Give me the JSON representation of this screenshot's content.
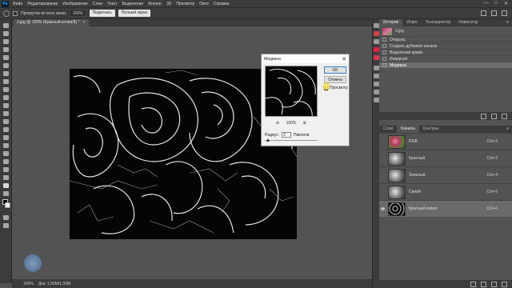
{
  "menu": {
    "items": [
      "Файл",
      "Редактирование",
      "Изображение",
      "Слои",
      "Текст",
      "Выделение",
      "Фильтр",
      "3D",
      "Просмотр",
      "Окно",
      "Справка"
    ],
    "window_controls": [
      "—",
      "□",
      "✕"
    ]
  },
  "options": {
    "scroll_all_label": "Прокрутка во всех окнах",
    "zoom_value": "100%",
    "fit_button": "Подогнать",
    "fill_button": "Полный экран"
  },
  "document": {
    "tab_title": "3.jpg @ 100% (Красный копия/8) *",
    "close": "×"
  },
  "status": {
    "zoom": "100%",
    "doc_info": "Док: 1,50M/1,50M"
  },
  "dialog": {
    "title": "Медиана",
    "close": "✕",
    "ok_label": "OK",
    "cancel_label": "Отмена",
    "preview_label": "Просмотр",
    "preview_checked": true,
    "zoom_out": "⊖",
    "zoom_value": "100%",
    "zoom_in": "⊕",
    "radius_label": "Радиус:",
    "radius_value": "2",
    "radius_unit": "Пиксели"
  },
  "history": {
    "tabs": [
      "История",
      "Инфо",
      "Тонкорректор",
      "Навигатор"
    ],
    "snapshot": "3.jpg",
    "items": [
      {
        "label": "Открыть",
        "selected": false
      },
      {
        "label": "Создать дубликат канала",
        "selected": false
      },
      {
        "label": "Выделение краев",
        "selected": false
      },
      {
        "label": "Инверсия",
        "selected": false
      },
      {
        "label": "Медиана",
        "selected": true
      }
    ]
  },
  "channels": {
    "tabs": [
      "Слои",
      "Каналы",
      "Контуры"
    ],
    "rows": [
      {
        "name": "RGB",
        "shortcut": "Ctrl+2",
        "visible": false,
        "selected": false,
        "thumb": "color"
      },
      {
        "name": "Красный",
        "shortcut": "Ctrl+3",
        "visible": false,
        "selected": false,
        "thumb": "gray"
      },
      {
        "name": "Зеленый",
        "shortcut": "Ctrl+4",
        "visible": false,
        "selected": false,
        "thumb": "gray"
      },
      {
        "name": "Синий",
        "shortcut": "Ctrl+5",
        "visible": false,
        "selected": false,
        "thumb": "gray"
      },
      {
        "name": "Красный копия",
        "shortcut": "Ctrl+6",
        "visible": true,
        "selected": true,
        "thumb": "edge"
      }
    ]
  },
  "colors": {
    "app_bg": "#535353",
    "panel_bg": "#3c3c3c",
    "selection": "#6f6f6f",
    "accent": "#31a8ff"
  }
}
